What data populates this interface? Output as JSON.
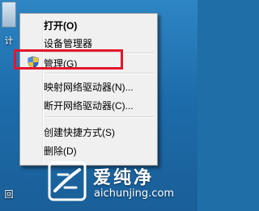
{
  "desktop": {
    "icons": [
      {
        "label": "计"
      },
      {
        "label": "回"
      }
    ]
  },
  "context_menu": {
    "items": [
      {
        "label": "打开(O)",
        "bold": true
      },
      {
        "label": "设备管理器"
      },
      {
        "label": "管理(G)",
        "icon": "uac-shield-icon",
        "highlighted": true
      },
      {
        "label": "映射网络驱动器(N)..."
      },
      {
        "label": "断开网络驱动器(C)..."
      },
      {
        "label": "创建快捷方式(S)"
      },
      {
        "label": "删除(D)"
      }
    ],
    "highlight_color": "#e3162b"
  },
  "watermark": {
    "title": "爱纯净",
    "url": "aichunjing.com"
  }
}
